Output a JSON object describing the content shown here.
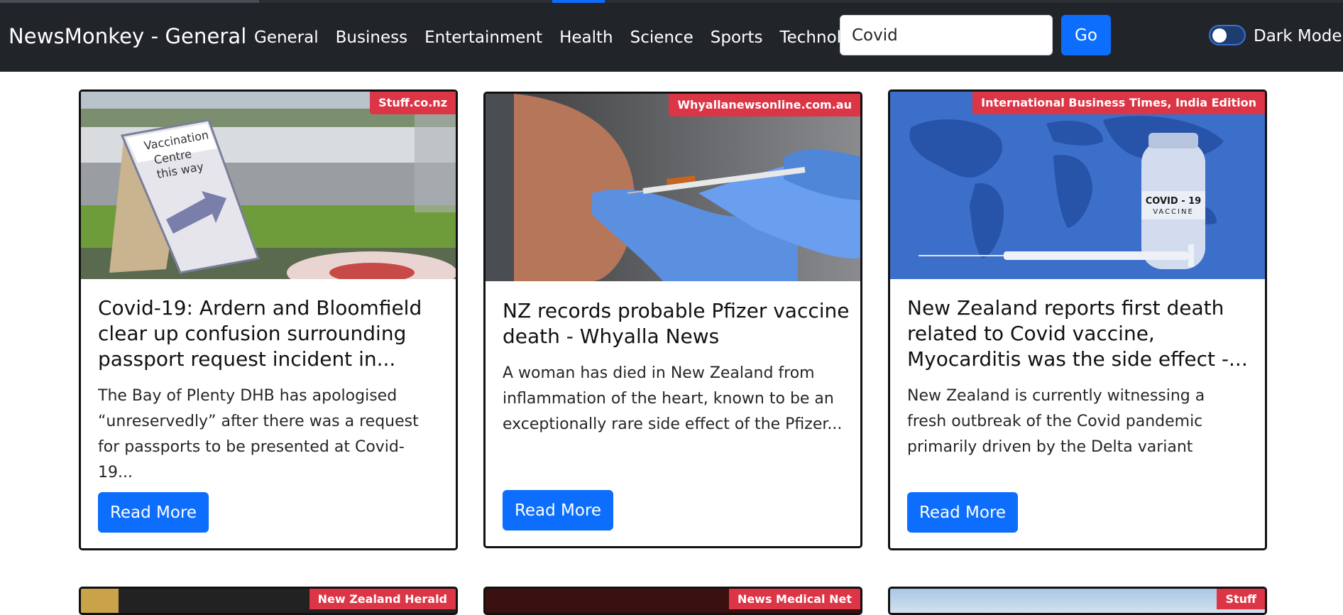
{
  "navbar": {
    "brand": "NewsMonkey - General",
    "links": [
      "General",
      "Business",
      "Entertainment",
      "Health",
      "Science",
      "Sports",
      "Technology"
    ],
    "search": {
      "value": "Covid",
      "go_label": "Go"
    },
    "dark_mode_label": "Dark Mode",
    "dark_mode_on": false
  },
  "cards": [
    {
      "source": "Stuff.co.nz",
      "title": "Covid-19: Ardern and Bloomfield clear up confusion surrounding passport request incident in...",
      "description": "The Bay of Plenty DHB has apologised “unreservedly” after there was a request for passports to be presented at Covid-19...",
      "button": "Read More",
      "image_sign_text": [
        "Vaccination",
        "Centre",
        "this way"
      ]
    },
    {
      "source": "Whyallanewsonline.com.au",
      "title": "NZ records probable Pfizer vaccine death - Whyalla News",
      "description": "A woman has died in New Zealand from inflammation of the heart, known to be an exceptionally rare side effect of the Pfizer...",
      "button": "Read More"
    },
    {
      "source": "International Business Times, India Edition",
      "title": "New Zealand reports first death related to Covid vaccine, Myocarditis was the side effect -...",
      "description": "New Zealand is currently witnessing a fresh outbreak of the Covid pandemic primarily driven by the Delta variant",
      "button": "Read More",
      "image_vial_text": [
        "COVID - 19",
        "VACCINE"
      ]
    }
  ],
  "peek_cards": [
    {
      "source": "New Zealand Herald"
    },
    {
      "source": "News Medical Net"
    },
    {
      "source": "Stuff"
    }
  ],
  "colors": {
    "navbar_bg": "#212529",
    "primary": "#0d6efd",
    "badge": "#dc3545"
  }
}
